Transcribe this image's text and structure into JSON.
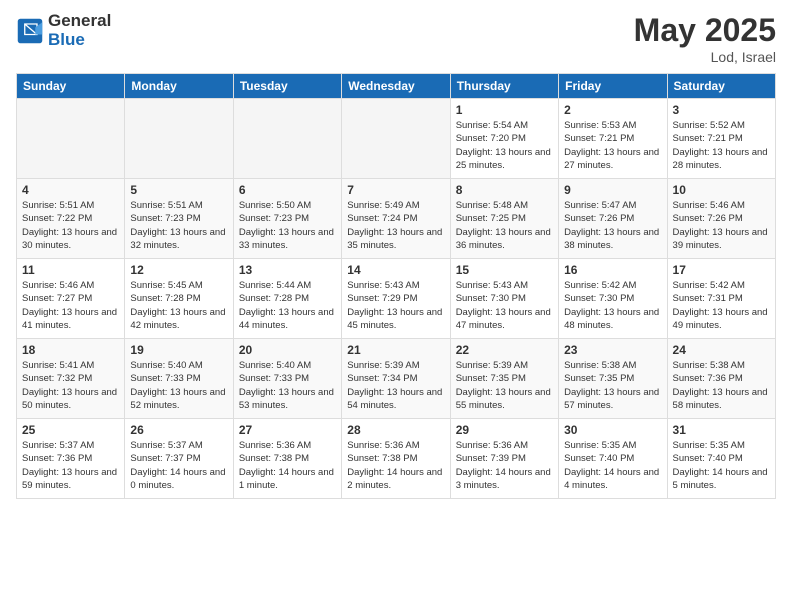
{
  "header": {
    "logo_general": "General",
    "logo_blue": "Blue",
    "month": "May 2025",
    "location": "Lod, Israel"
  },
  "days_of_week": [
    "Sunday",
    "Monday",
    "Tuesday",
    "Wednesday",
    "Thursday",
    "Friday",
    "Saturday"
  ],
  "weeks": [
    [
      {
        "day": "",
        "empty": true
      },
      {
        "day": "",
        "empty": true
      },
      {
        "day": "",
        "empty": true
      },
      {
        "day": "",
        "empty": true
      },
      {
        "day": "1",
        "sunrise": "5:54 AM",
        "sunset": "7:20 PM",
        "daylight": "13 hours and 25 minutes."
      },
      {
        "day": "2",
        "sunrise": "5:53 AM",
        "sunset": "7:21 PM",
        "daylight": "13 hours and 27 minutes."
      },
      {
        "day": "3",
        "sunrise": "5:52 AM",
        "sunset": "7:21 PM",
        "daylight": "13 hours and 28 minutes."
      }
    ],
    [
      {
        "day": "4",
        "sunrise": "5:51 AM",
        "sunset": "7:22 PM",
        "daylight": "13 hours and 30 minutes."
      },
      {
        "day": "5",
        "sunrise": "5:51 AM",
        "sunset": "7:23 PM",
        "daylight": "13 hours and 32 minutes."
      },
      {
        "day": "6",
        "sunrise": "5:50 AM",
        "sunset": "7:23 PM",
        "daylight": "13 hours and 33 minutes."
      },
      {
        "day": "7",
        "sunrise": "5:49 AM",
        "sunset": "7:24 PM",
        "daylight": "13 hours and 35 minutes."
      },
      {
        "day": "8",
        "sunrise": "5:48 AM",
        "sunset": "7:25 PM",
        "daylight": "13 hours and 36 minutes."
      },
      {
        "day": "9",
        "sunrise": "5:47 AM",
        "sunset": "7:26 PM",
        "daylight": "13 hours and 38 minutes."
      },
      {
        "day": "10",
        "sunrise": "5:46 AM",
        "sunset": "7:26 PM",
        "daylight": "13 hours and 39 minutes."
      }
    ],
    [
      {
        "day": "11",
        "sunrise": "5:46 AM",
        "sunset": "7:27 PM",
        "daylight": "13 hours and 41 minutes."
      },
      {
        "day": "12",
        "sunrise": "5:45 AM",
        "sunset": "7:28 PM",
        "daylight": "13 hours and 42 minutes."
      },
      {
        "day": "13",
        "sunrise": "5:44 AM",
        "sunset": "7:28 PM",
        "daylight": "13 hours and 44 minutes."
      },
      {
        "day": "14",
        "sunrise": "5:43 AM",
        "sunset": "7:29 PM",
        "daylight": "13 hours and 45 minutes."
      },
      {
        "day": "15",
        "sunrise": "5:43 AM",
        "sunset": "7:30 PM",
        "daylight": "13 hours and 47 minutes."
      },
      {
        "day": "16",
        "sunrise": "5:42 AM",
        "sunset": "7:30 PM",
        "daylight": "13 hours and 48 minutes."
      },
      {
        "day": "17",
        "sunrise": "5:42 AM",
        "sunset": "7:31 PM",
        "daylight": "13 hours and 49 minutes."
      }
    ],
    [
      {
        "day": "18",
        "sunrise": "5:41 AM",
        "sunset": "7:32 PM",
        "daylight": "13 hours and 50 minutes."
      },
      {
        "day": "19",
        "sunrise": "5:40 AM",
        "sunset": "7:33 PM",
        "daylight": "13 hours and 52 minutes."
      },
      {
        "day": "20",
        "sunrise": "5:40 AM",
        "sunset": "7:33 PM",
        "daylight": "13 hours and 53 minutes."
      },
      {
        "day": "21",
        "sunrise": "5:39 AM",
        "sunset": "7:34 PM",
        "daylight": "13 hours and 54 minutes."
      },
      {
        "day": "22",
        "sunrise": "5:39 AM",
        "sunset": "7:35 PM",
        "daylight": "13 hours and 55 minutes."
      },
      {
        "day": "23",
        "sunrise": "5:38 AM",
        "sunset": "7:35 PM",
        "daylight": "13 hours and 57 minutes."
      },
      {
        "day": "24",
        "sunrise": "5:38 AM",
        "sunset": "7:36 PM",
        "daylight": "13 hours and 58 minutes."
      }
    ],
    [
      {
        "day": "25",
        "sunrise": "5:37 AM",
        "sunset": "7:36 PM",
        "daylight": "13 hours and 59 minutes."
      },
      {
        "day": "26",
        "sunrise": "5:37 AM",
        "sunset": "7:37 PM",
        "daylight": "14 hours and 0 minutes."
      },
      {
        "day": "27",
        "sunrise": "5:36 AM",
        "sunset": "7:38 PM",
        "daylight": "14 hours and 1 minute."
      },
      {
        "day": "28",
        "sunrise": "5:36 AM",
        "sunset": "7:38 PM",
        "daylight": "14 hours and 2 minutes."
      },
      {
        "day": "29",
        "sunrise": "5:36 AM",
        "sunset": "7:39 PM",
        "daylight": "14 hours and 3 minutes."
      },
      {
        "day": "30",
        "sunrise": "5:35 AM",
        "sunset": "7:40 PM",
        "daylight": "14 hours and 4 minutes."
      },
      {
        "day": "31",
        "sunrise": "5:35 AM",
        "sunset": "7:40 PM",
        "daylight": "14 hours and 5 minutes."
      }
    ]
  ],
  "labels": {
    "sunrise_prefix": "Sunrise: ",
    "sunset_prefix": "Sunset: ",
    "daylight_prefix": "Daylight: "
  }
}
